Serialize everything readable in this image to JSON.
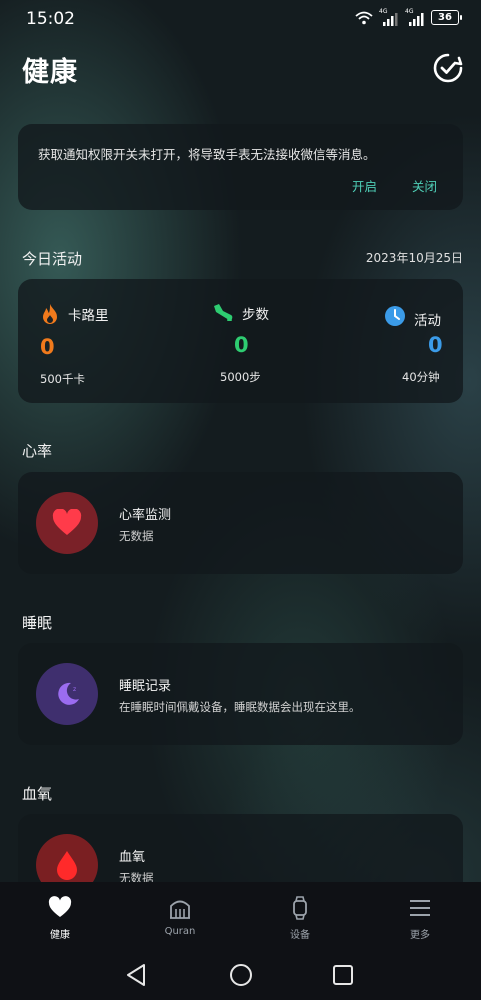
{
  "status_bar": {
    "time": "15:02",
    "signal1_label": "4G",
    "signal2_label": "4G",
    "battery": "36"
  },
  "header": {
    "title": "健康",
    "action_icon": "check-circle-icon"
  },
  "notice": {
    "text": "获取通知权限开关未打开，将导致手表无法接收微信等消息。",
    "open_label": "开启",
    "close_label": "关闭",
    "accent_color": "#4fd0b8"
  },
  "activity": {
    "section_label": "今日活动",
    "date": "2023年10月25日",
    "metrics": [
      {
        "name": "卡路里",
        "icon": "flame-icon",
        "value": "0",
        "goal": "500千卡",
        "color": "#f07a1c"
      },
      {
        "name": "步数",
        "icon": "shoe-icon",
        "value": "0",
        "goal": "5000步",
        "color": "#2ecc71"
      },
      {
        "name": "活动",
        "icon": "clock-icon",
        "value": "0",
        "goal": "40分钟",
        "color": "#3b9be8"
      }
    ]
  },
  "heart": {
    "section_label": "心率",
    "title": "心率监测",
    "subtitle": "无数据",
    "icon": "heart-icon"
  },
  "sleep": {
    "section_label": "睡眠",
    "title": "睡眠记录",
    "subtitle": "在睡眠时间佩戴设备，睡眠数据会出现在这里。",
    "icon": "moon-icon"
  },
  "oxygen": {
    "section_label": "血氧",
    "title": "血氧",
    "subtitle": "无数据",
    "icon": "blood-drop-icon"
  },
  "bottom_nav": {
    "items": [
      {
        "label": "健康",
        "icon": "heart-icon",
        "active": true
      },
      {
        "label": "Quran",
        "icon": "mosque-icon",
        "active": false
      },
      {
        "label": "设备",
        "icon": "watch-icon",
        "active": false
      },
      {
        "label": "更多",
        "icon": "menu-icon",
        "active": false
      }
    ]
  },
  "system_nav": {
    "back": "back-triangle-icon",
    "home": "home-circle-icon",
    "recent": "recent-square-icon"
  }
}
